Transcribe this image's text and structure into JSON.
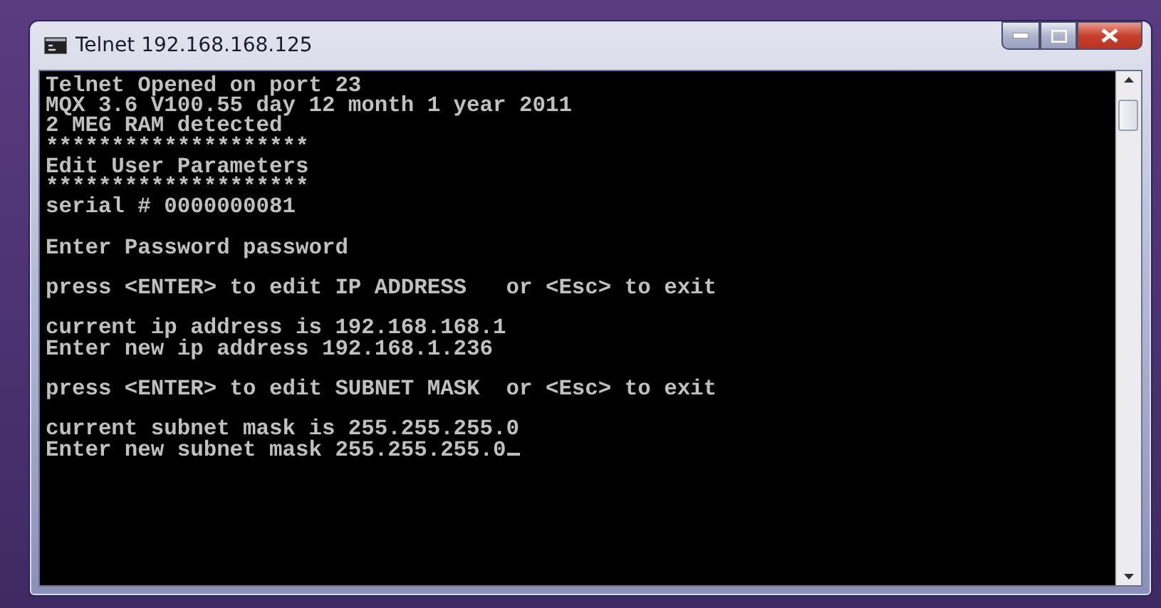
{
  "window": {
    "title": "Telnet 192.168.168.125"
  },
  "console": {
    "cursor": true,
    "blocks": [
      [
        "Telnet Opened on port 23",
        "MQX 3.6 V100.55 day 12 month 1 year 2011",
        "2 MEG RAM detected",
        "********************",
        "Edit User Parameters",
        "********************",
        "serial # 0000000081"
      ],
      [
        "Enter Password password"
      ],
      [
        "press <ENTER> to edit IP ADDRESS   or <Esc> to exit"
      ],
      [
        "current ip address is 192.168.168.1",
        "Enter new ip address 192.168.1.236"
      ],
      [
        "press <ENTER> to edit SUBNET MASK  or <Esc> to exit"
      ],
      [
        "current subnet mask is 255.255.255.0",
        "Enter new subnet mask 255.255.255.0"
      ]
    ]
  }
}
